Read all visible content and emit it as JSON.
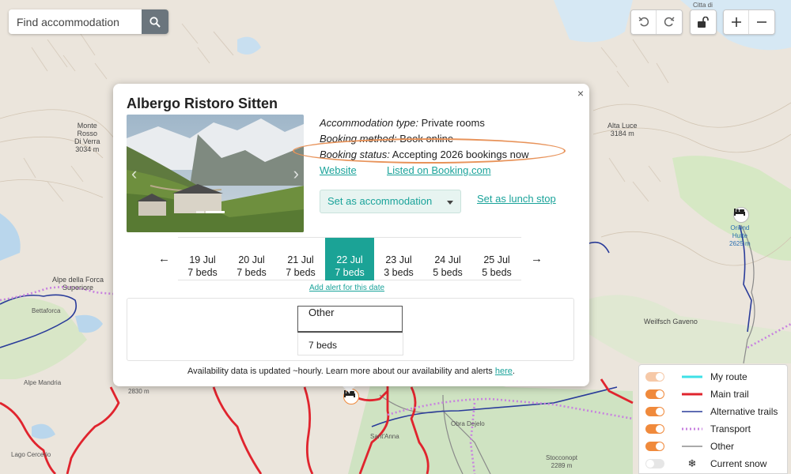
{
  "search": {
    "placeholder": "Find accommodation"
  },
  "map_labels": {
    "monte_rosso": "Monte\nRosso\nDi Verra\n3034 m",
    "alta_luce": "Alta Luce\n3184 m",
    "orionda": "Oriond\nHutte\n2625 m",
    "alpe_forca": "Alpe della Forca\nSuperiore",
    "bettaforca": "Bettaforca",
    "weilfsch": "Weilfsch Gaveno",
    "alpe_mandria": "Alpe Mandria",
    "m2830": "2830 m",
    "lago_cercerio": "Lago Cercerio",
    "sant_anna": "Sant'Anna",
    "obra": "Obra Dejelo",
    "stocconopt": "Stocconopt\n2289 m",
    "citta": "Citta di"
  },
  "popup": {
    "title": "Albergo Ristoro Sitten",
    "close": "×",
    "type_label": "Accommodation type:",
    "type_value": "Private rooms",
    "method_label": "Booking method:",
    "method_value": "Book online",
    "status_label": "Booking status:",
    "status_value": "Accepting 2026 bookings now",
    "website": "Website",
    "booking_link": "Listed on Booking.com",
    "set_accommodation": "Set as accommodation",
    "set_lunch": "Set as lunch stop",
    "prev": "←",
    "next": "→",
    "dates": [
      {
        "date": "19 Jul",
        "beds": "7 beds",
        "active": false
      },
      {
        "date": "20 Jul",
        "beds": "7 beds",
        "active": false
      },
      {
        "date": "21 Jul",
        "beds": "7 beds",
        "active": false
      },
      {
        "date": "22 Jul",
        "beds": "7 beds",
        "active": true
      },
      {
        "date": "23 Jul",
        "beds": "3 beds",
        "active": false
      },
      {
        "date": "24 Jul",
        "beds": "5 beds",
        "active": false
      },
      {
        "date": "25 Jul",
        "beds": "5 beds",
        "active": false
      }
    ],
    "add_alert": "Add alert for this date",
    "room_type": "Other",
    "room_beds": "7 beds",
    "footer_text": "Availability data is updated ~hourly. Learn more about our availability and alerts ",
    "footer_link": "here",
    "footer_end": "."
  },
  "legend": [
    {
      "label": "My route",
      "color": "#3ee0e6",
      "style": "solid"
    },
    {
      "label": "Main trail",
      "color": "#e0242e",
      "style": "solid"
    },
    {
      "label": "Alternative trails",
      "color": "#2a3c9a",
      "style": "thin"
    },
    {
      "label": "Transport",
      "color": "#c882e0",
      "style": "dotted"
    },
    {
      "label": "Other",
      "color": "#777777",
      "style": "thin"
    },
    {
      "label": "Current snow",
      "color": "#222222",
      "style": "snow"
    }
  ],
  "colors": {
    "accent": "#1ba396",
    "highlight": "#e8935a",
    "toggle": "#f08a3c"
  }
}
